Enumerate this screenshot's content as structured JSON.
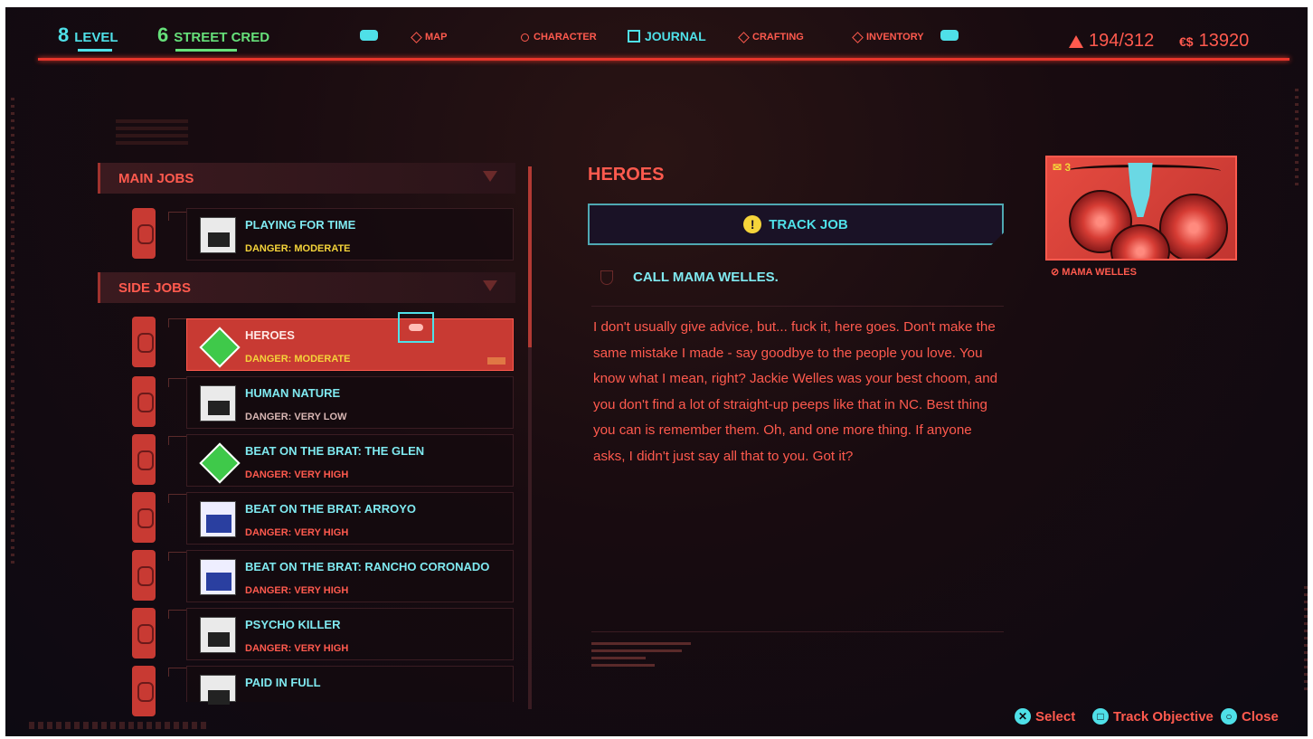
{
  "header": {
    "level": {
      "value": "8",
      "label": "LEVEL"
    },
    "street_cred": {
      "value": "6",
      "label": "STREET CRED"
    },
    "nav": [
      {
        "label": "MAP",
        "icon": "diamond-icon"
      },
      {
        "label": "CHARACTER",
        "icon": "gear-icon"
      },
      {
        "label": "JOURNAL",
        "icon": "journal-icon",
        "active": true
      },
      {
        "label": "CRAFTING",
        "icon": "crafting-icon"
      },
      {
        "label": "INVENTORY",
        "icon": "diamond-icon"
      }
    ],
    "carry_weight": "194/312",
    "money": "13920",
    "money_symbol": "€$"
  },
  "sections": {
    "main_jobs": "MAIN JOBS",
    "side_jobs": "SIDE JOBS"
  },
  "main_jobs": [
    {
      "title": "PLAYING FOR TIME",
      "danger": "DANGER: MODERATE",
      "danger_color": "#f5d43a"
    }
  ],
  "side_jobs": [
    {
      "title": "HEROES",
      "danger": "DANGER: MODERATE",
      "danger_color": "#f5d43a",
      "selected": true
    },
    {
      "title": "HUMAN NATURE",
      "danger": "DANGER: VERY LOW",
      "danger_color": "#d9b7b4"
    },
    {
      "title": "BEAT ON THE BRAT: THE GLEN",
      "danger": "DANGER: VERY HIGH",
      "danger_color": "#ff5a4e"
    },
    {
      "title": "BEAT ON THE BRAT: ARROYO",
      "danger": "DANGER: VERY HIGH",
      "danger_color": "#ff5a4e"
    },
    {
      "title": "BEAT ON THE BRAT: RANCHO CORONADO",
      "danger": "DANGER: VERY HIGH",
      "danger_color": "#ff5a4e"
    },
    {
      "title": "PSYCHO KILLER",
      "danger": "DANGER: VERY HIGH",
      "danger_color": "#ff5a4e"
    },
    {
      "title": "PAID IN FULL",
      "danger": "",
      "danger_color": "#ff5a4e"
    }
  ],
  "detail": {
    "title": "HEROES",
    "track_label": "TRACK JOB",
    "objective": "CALL MAMA WELLES.",
    "description": "I don't usually give advice, but... fuck it, here goes. Don't make the same mistake I made - say goodbye to the people you love. You know what I mean, right? Jackie Welles was your best choom, and you don't find a lot of straight-up peeps like that in NC. Best thing you can is remember them. Oh, and one more thing. If anyone asks, I didn't just say all that to you. Got it?"
  },
  "contact": {
    "messages": "3",
    "name": "MAMA WELLES"
  },
  "prompts": [
    {
      "label": "Select"
    },
    {
      "label": "Track Objective"
    },
    {
      "label": "Close"
    }
  ],
  "colors": {
    "accent_red": "#ff5a4e",
    "accent_cyan": "#4fe0e8",
    "danger_yellow": "#f5d43a"
  }
}
